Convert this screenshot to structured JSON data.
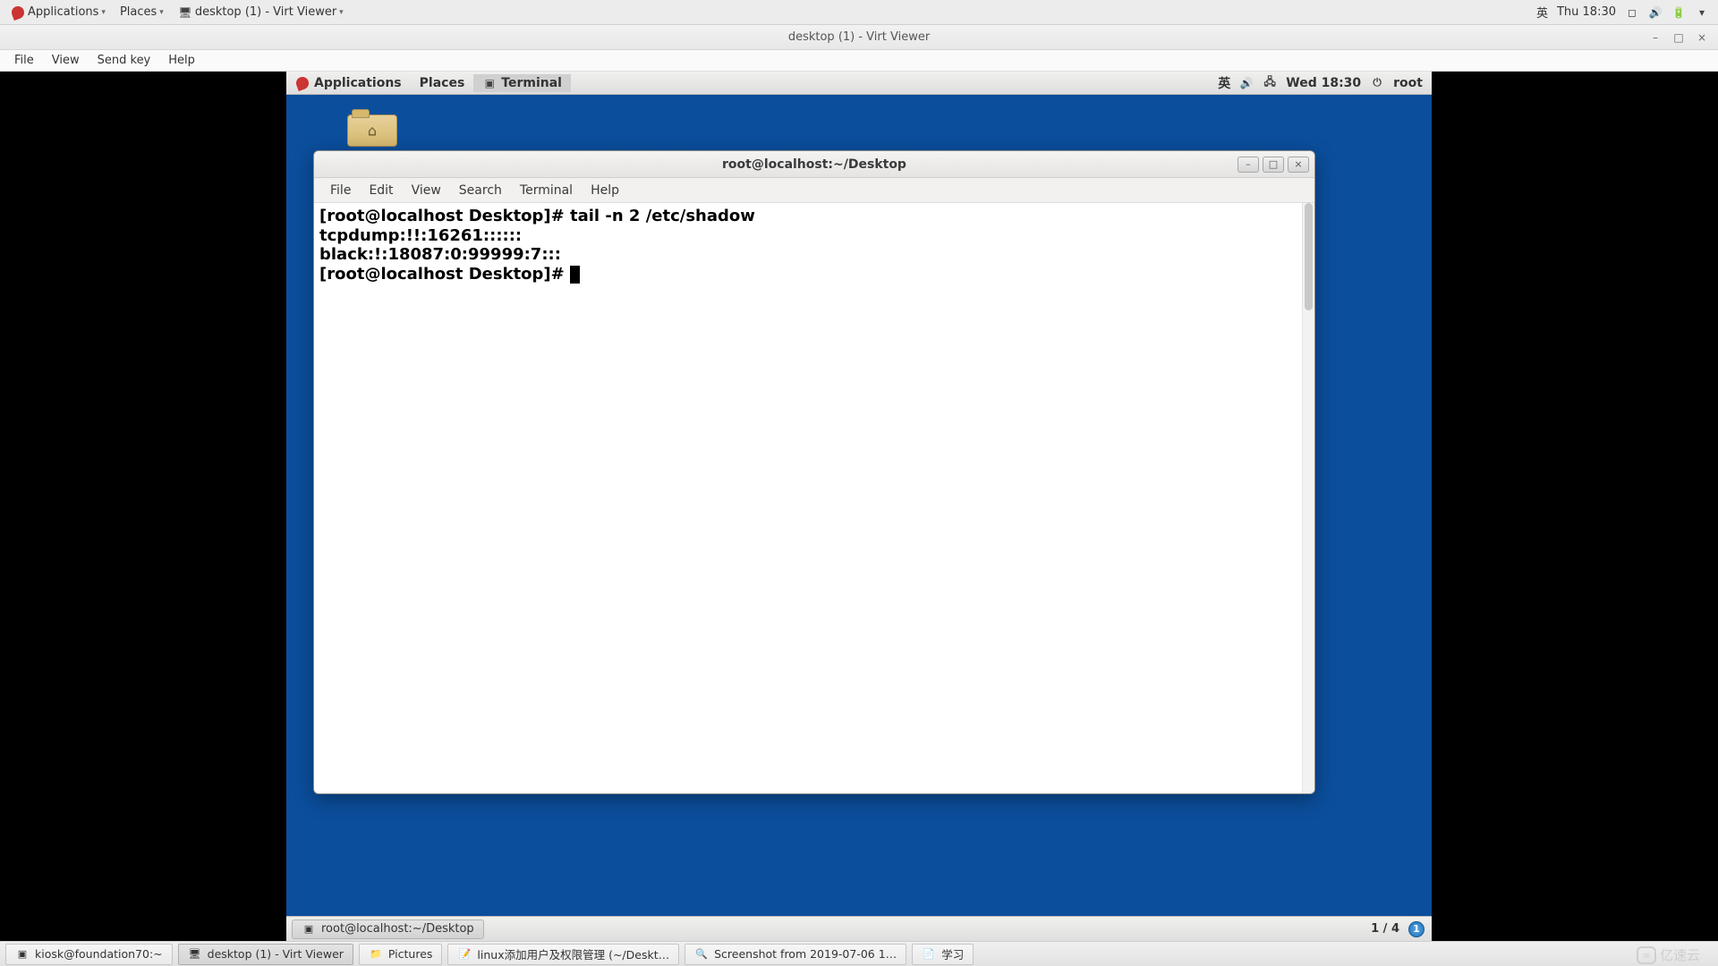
{
  "host": {
    "apps_label": "Applications",
    "places_label": "Places",
    "task_title": "desktop (1) - Virt Viewer",
    "ime": "英",
    "clock": "Thu 18:30"
  },
  "vv": {
    "title": "desktop (1) - Virt Viewer",
    "menus": {
      "file": "File",
      "view": "View",
      "sendkey": "Send key",
      "help": "Help"
    }
  },
  "guest_top": {
    "apps": "Applications",
    "places": "Places",
    "terminal": "Terminal",
    "ime": "英",
    "clock": "Wed 18:30",
    "user": "root"
  },
  "terminal": {
    "title": "root@localhost:~/Desktop",
    "menus": {
      "file": "File",
      "edit": "Edit",
      "view": "View",
      "search": "Search",
      "terminal": "Terminal",
      "help": "Help"
    },
    "lines": {
      "l0": "[root@localhost Desktop]# tail -n 2 /etc/shadow",
      "l1": "tcpdump:!!:16261::::::",
      "l2": "black:!:18087:0:99999:7:::",
      "l3": "[root@localhost Desktop]# "
    }
  },
  "guest_bottom": {
    "win_entry": "root@localhost:~/Desktop",
    "workspace": "1 / 4",
    "ws_badge": "1"
  },
  "host_tasks": {
    "t0": "kiosk@foundation70:~",
    "t1": "desktop (1) - Virt Viewer",
    "t2": "Pictures",
    "t3": "linux添加用户及权限管理 (~/Deskt…",
    "t4": "Screenshot from 2019-07-06 1…",
    "t5": "学习"
  },
  "watermark": "亿速云"
}
